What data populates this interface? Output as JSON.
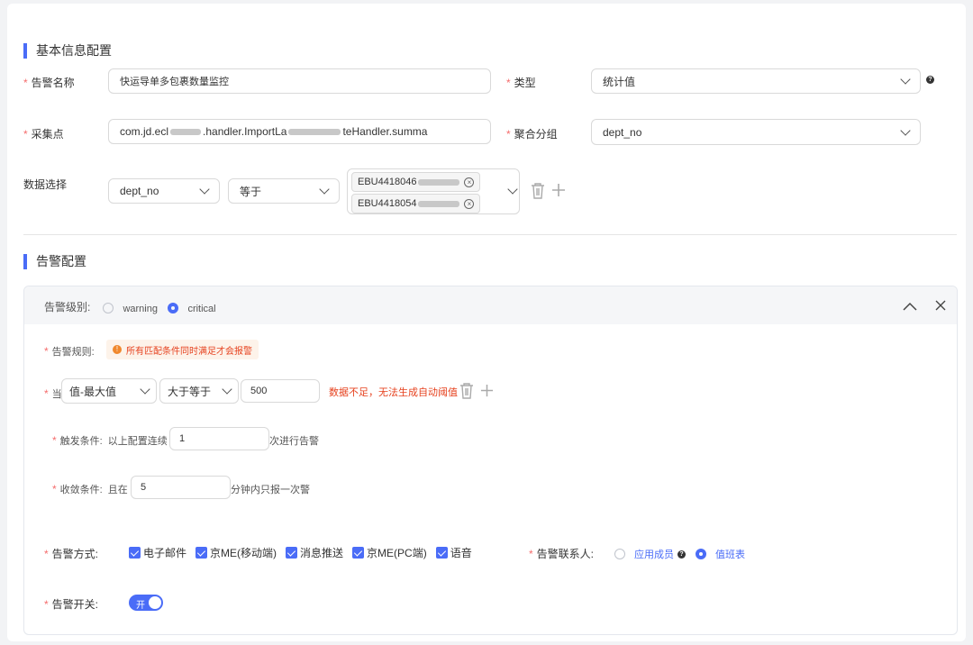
{
  "basic": {
    "section_title": "基本信息配置",
    "alarm_name_label": "告警名称",
    "alarm_name_value": "快运导单多包裹数量监控",
    "type_label": "类型",
    "type_value": "统计值",
    "collect_label": "采集点",
    "collect_value_a": "com.jd.ecl",
    "collect_value_b": ".handler.ImportLa",
    "collect_value_c": "teHandler.summa",
    "group_label": "聚合分组",
    "group_value": "dept_no",
    "data_label": "数据选择",
    "data_field": "dept_no",
    "data_op": "等于",
    "tags": [
      "EBU4418046",
      "EBU4418054"
    ]
  },
  "alarm": {
    "section_title": "告警配置",
    "level_label": "告警级别:",
    "level_options": [
      "warning",
      "critical"
    ],
    "level_selected": "critical",
    "rule_label": "告警规则:",
    "rule_badge": "所有匹配条件同时满足才会报警",
    "when_label": "当",
    "metric": "值-最大值",
    "comparator": "大于等于",
    "threshold": "500",
    "threshold_warning": "数据不足，无法生成自动阈值",
    "trigger_label": "触发条件:",
    "trigger_prefix": "以上配置连续",
    "trigger_value": "1",
    "trigger_suffix": "次进行告警",
    "converge_label": "收敛条件:",
    "converge_prefix": "且在",
    "converge_value": "5",
    "converge_suffix": "分钟内只报一次警",
    "method_label": "告警方式:",
    "methods": [
      "电子邮件",
      "京ME(移动端)",
      "消息推送",
      "京ME(PC端)",
      "语音"
    ],
    "contact_label": "告警联系人:",
    "contact_options": [
      "应用成员",
      "值班表"
    ],
    "contact_selected": "值班表",
    "switch_label": "告警开关:",
    "switch_text": "开"
  },
  "colors": {
    "accent": "#4a6cf7",
    "required": "#f56c6c",
    "warning_text": "#e6421f"
  }
}
